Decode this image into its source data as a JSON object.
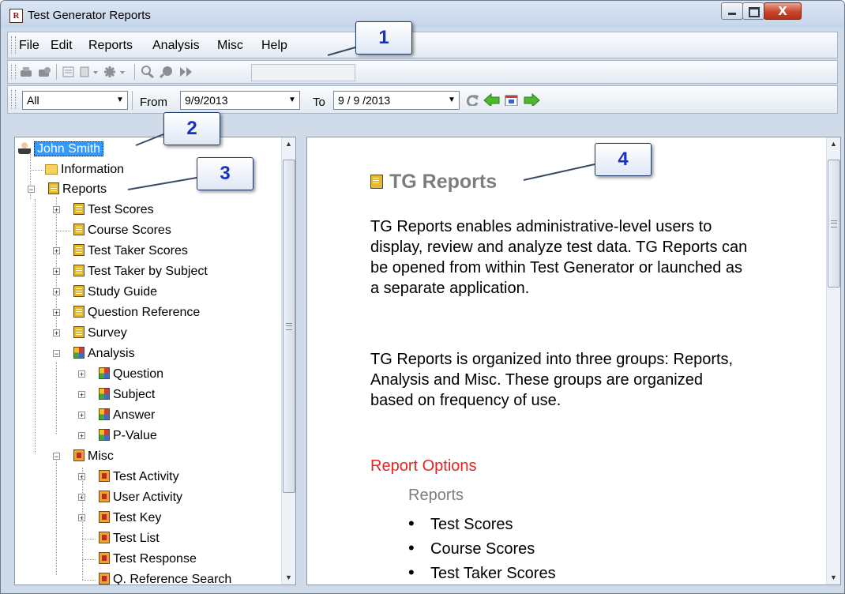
{
  "window": {
    "title": "Test Generator Reports",
    "close_glyph": "X"
  },
  "menu": [
    "File",
    "Edit",
    "Reports",
    "Analysis",
    "Misc",
    "Help"
  ],
  "toolbar_icons": [
    "print-icon",
    "print-preview-icon",
    "report-view-icon",
    "export-icon",
    "settings-icon",
    "search-icon",
    "find-icon",
    "next-icon"
  ],
  "filters": {
    "scope": "All",
    "from_label": "From",
    "from_value": "9/9/2013",
    "to_label": "To",
    "to_value": "9 / 9 /2013"
  },
  "tree": {
    "user": "John Smith",
    "information": "Information",
    "reports": {
      "label": "Reports",
      "items": [
        "Test Scores",
        "Course Scores",
        "Test Taker Scores",
        "Test Taker by Subject",
        "Study Guide",
        "Question Reference",
        "Survey"
      ]
    },
    "analysis": {
      "label": "Analysis",
      "items": [
        "Question",
        "Subject",
        "Answer",
        "P-Value"
      ]
    },
    "misc": {
      "label": "Misc",
      "items": [
        "Test Activity",
        "User Activity",
        "Test Key",
        "Test List",
        "Test Response",
        "Q. Reference Search"
      ]
    }
  },
  "content": {
    "title": "TG Reports",
    "para1": "TG Reports enables administrative-level users to display, review and analyze test data.  TG Reports can be opened from within Test Generator or launched as a separate application.",
    "para2": "TG Reports is organized into three groups: Reports, Analysis and Misc.  These groups are organized based on frequency of use.",
    "section_title": "Report Options",
    "subheading": "Reports",
    "bullets": [
      "Test Scores",
      "Course Scores",
      "Test Taker Scores"
    ]
  },
  "callouts": [
    "1",
    "2",
    "3",
    "4"
  ],
  "colors": {
    "selection": "#3399ff",
    "section_title": "#e82222",
    "callout_number": "#1731c4",
    "heading_gray": "#7d7d7d"
  }
}
